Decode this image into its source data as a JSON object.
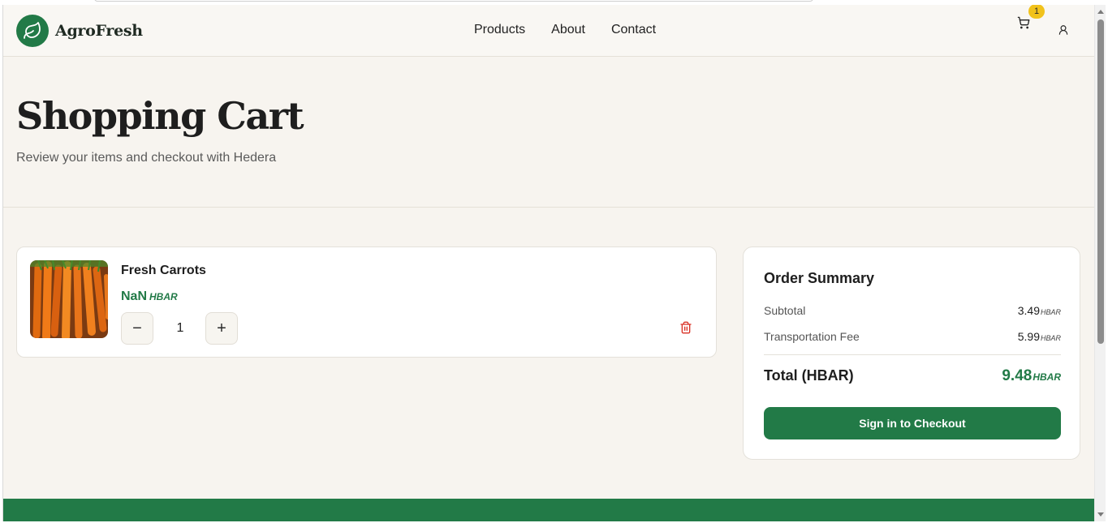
{
  "brand": {
    "name": "AgroFresh",
    "logo_icon": "leaf-icon",
    "accent": "#227a47"
  },
  "nav": {
    "items": [
      "Products",
      "About",
      "Contact"
    ]
  },
  "header": {
    "cart_icon": "cart-icon",
    "cart_count": "1",
    "user_icon": "user-icon"
  },
  "hero": {
    "title": "Shopping Cart",
    "subtitle": "Review your items and checkout with Hedera"
  },
  "cart": {
    "items": [
      {
        "name": "Fresh Carrots",
        "price": "NaN",
        "currency": "HBAR",
        "quantity": "1",
        "image": "carrots-photo"
      }
    ],
    "minus_label": "−",
    "plus_label": "+",
    "delete_icon": "trash-icon"
  },
  "summary": {
    "title": "Order Summary",
    "subtotal_label": "Subtotal",
    "subtotal_value": "3.49",
    "transport_label": "Transportation Fee",
    "transport_value": "5.99",
    "currency": "HBAR",
    "total_label": "Total (HBAR)",
    "total_value": "9.48",
    "checkout_label": "Sign in to Checkout"
  },
  "colors": {
    "background": "#f7f4ef",
    "badge": "#f1c21b",
    "delete": "#d93025"
  }
}
